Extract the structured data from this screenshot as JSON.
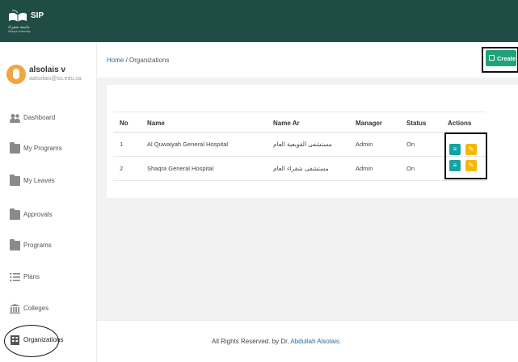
{
  "app": {
    "logo_text": "SIP",
    "logo_arabic": "جامعة شقراء",
    "logo_sub": "Shaqra University"
  },
  "user": {
    "name": "alsolais",
    "caret": "v",
    "email": "aalsolais@su.edu.sa"
  },
  "sidebar": {
    "items": [
      {
        "label": "Dashboard",
        "icon": "people-icon"
      },
      {
        "label": "My Programs",
        "icon": "folder-icon"
      },
      {
        "label": "My Leaves",
        "icon": "folder-icon"
      },
      {
        "label": "Approvals",
        "icon": "folder-icon"
      },
      {
        "label": "Programs",
        "icon": "folder-icon"
      },
      {
        "label": "Plans",
        "icon": "list-icon"
      },
      {
        "label": "Colleges",
        "icon": "building-icon"
      },
      {
        "label": "Organizations",
        "icon": "grid-icon"
      }
    ]
  },
  "breadcrumb": {
    "home": "Home",
    "separator": "/",
    "current": "Organizations"
  },
  "toolbar": {
    "create_label": "Create"
  },
  "table": {
    "headers": [
      "No",
      "Name",
      "Name Ar",
      "Manager",
      "Status",
      "Actions"
    ],
    "rows": [
      {
        "no": "1",
        "name": "Al Quwaiyah General Hospital",
        "name_ar": "مستشفى القويعية العام",
        "manager": "Admin",
        "status": "On"
      },
      {
        "no": "2",
        "name": "Shaqra General Hospital",
        "name_ar": "مستشفى شقراء العام",
        "manager": "Admin",
        "status": "On"
      }
    ]
  },
  "footer": {
    "text": "All Rights Reserved. by Dr.",
    "author": "Abdullah Alsolais",
    "end": "."
  },
  "colors": {
    "topbar": "#1f4d45",
    "create": "#21a37a",
    "view": "#17a2a2",
    "edit": "#f5b800"
  }
}
